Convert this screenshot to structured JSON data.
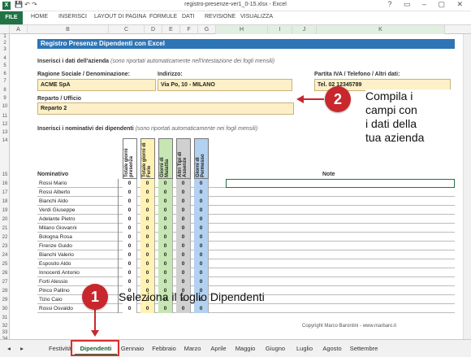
{
  "window": {
    "title": "registro-presenze-ver1_0-15.xlsx - Excel",
    "app_icon": "X",
    "controls": "? ▭ – ▢ ✕"
  },
  "ribbon": {
    "tabs": [
      "FILE",
      "HOME",
      "INSERISCI",
      "LAYOUT DI PAGINA",
      "FORMULE",
      "DATI",
      "REVISIONE",
      "VISUALIZZA"
    ]
  },
  "columns": [
    "A",
    "B",
    "C",
    "D",
    "E",
    "F",
    "G",
    "H",
    "I",
    "J",
    "K"
  ],
  "rows": [
    "1",
    "2",
    "3",
    "4",
    "5",
    "6",
    "7",
    "8",
    "9",
    "10",
    "11",
    "12",
    "13",
    "14",
    "15",
    "16",
    "17",
    "18",
    "19",
    "20",
    "21",
    "22",
    "23",
    "24",
    "25",
    "26",
    "27",
    "28",
    "29",
    "30",
    "31",
    "32",
    "33",
    "34",
    "35"
  ],
  "sheet": {
    "banner": "Registro Presenze Dipendenti con Excel",
    "company_section": "Inserisci i dati dell'azienda",
    "company_hint": "(sono riportati automaticamente nell'intestazione dei fogli mensili)",
    "ragione_label": "Ragione Sociale / Denominazione:",
    "ragione_value": "ACME SpA",
    "indirizzo_label": "Indirizzo:",
    "indirizzo_value": "Via Po, 10 - MILANO",
    "piva_label": "Partita IVA / Telefono / Altri dati:",
    "piva_value": "Tel. 02 12345789",
    "reparto_label": "Reparto / Ufficio",
    "reparto_value": "Reparto 2",
    "employees_section": "Inserisci i nominativi dei dipendenti",
    "employees_hint": "(sono riportati automaticamente nei fogli mensili)",
    "col_nominativo": "Nominativo",
    "col_note": "Note",
    "vheaders": [
      "Totale giorni presenza",
      "Totale giorni di Ferie",
      "Giorni di Malattia",
      "Altri Tipi di Assenze",
      "Giorni di Permesso"
    ],
    "vheader_colors": [
      "#ffffff",
      "#fff2b3",
      "#c6e6b3",
      "#d0d0d0",
      "#b3d1f0"
    ],
    "employees": [
      "Rossi Mario",
      "Rossi Alberto",
      "Bianchi Aldo",
      "Verdi Giuseppe",
      "Adelante Pietro",
      "Milano Giovanni",
      "Bologna Rosa",
      "Firenze Guido",
      "Bianchi Valerio",
      "Esposito Aldo",
      "Innocenti Antonio",
      "Forti Alessio",
      "Pinco Pallino",
      "Tizio Caio",
      "Rossi Osvaldo"
    ],
    "zero": "0",
    "copyright": "Copyright Marco Barontini - www.marbaro.it"
  },
  "sheet_tabs": [
    "Festività",
    "Dipendenti",
    "Gennaio",
    "Febbraio",
    "Marzo",
    "Aprile",
    "Maggio",
    "Giugno",
    "Luglio",
    "Agosto",
    "Settembre"
  ],
  "sheet_nav": {
    "prev": "◂",
    "next": "▸"
  },
  "annotations": {
    "step1_number": "1",
    "step1_text": "Seleziona il foglio Dipendenti",
    "step2_number": "2",
    "step2_line1": "Compila i",
    "step2_line2": "campi con",
    "step2_line3": "i dati della",
    "step2_line4": "tua azienda"
  }
}
